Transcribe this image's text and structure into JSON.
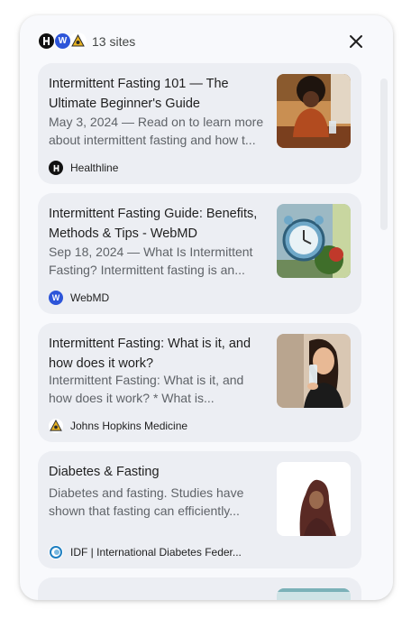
{
  "header": {
    "sites_count": "13 sites",
    "favicons": [
      "healthline-icon",
      "webmd-icon",
      "hopkins-icon"
    ]
  },
  "colors": {
    "panel_bg": "#f8f9fc",
    "card_bg": "#eceef3",
    "webmd_blue": "#2d55d9"
  },
  "results": [
    {
      "title": "Intermittent Fasting 101 — The Ultimate Beginner's Guide",
      "snippet": "May 3, 2024 — Read on to learn more about intermittent fasting and how t...",
      "source": "Healthline",
      "source_icon": "healthline-icon",
      "thumbnail": "woman-eating-at-table-photo"
    },
    {
      "title": "Intermittent Fasting Guide: Benefits, Methods & Tips - WebMD",
      "snippet": "Sep 18, 2024 — What Is Intermittent Fasting? Intermittent fasting is an...",
      "source": "WebMD",
      "source_icon": "webmd-icon",
      "thumbnail": "alarm-clock-with-salad-photo"
    },
    {
      "title": "Intermittent Fasting: What is it, and how does it work?",
      "snippet": "Intermittent Fasting: What is it, and how does it work? * What is...",
      "source": "Johns Hopkins Medicine",
      "source_icon": "hopkins-icon",
      "thumbnail": "woman-drinking-water-photo"
    },
    {
      "title": "Diabetes & Fasting",
      "snippet": "Diabetes and fasting. Studies have shown that fasting can efficiently...",
      "source": "IDF | International Diabetes Feder...",
      "source_icon": "idf-icon",
      "thumbnail": "woman-in-hijab-photo"
    }
  ]
}
